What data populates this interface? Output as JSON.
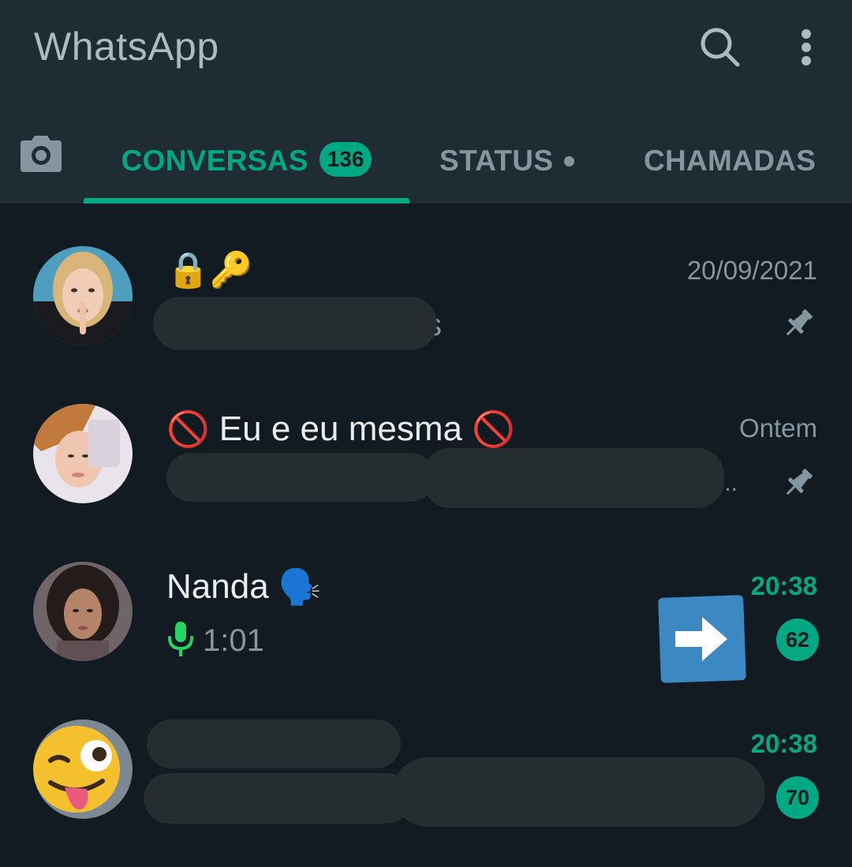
{
  "app": {
    "title": "WhatsApp",
    "search_icon": "search-icon",
    "menu_icon": "more-vert-icon"
  },
  "tabs": {
    "camera_icon": "camera-icon",
    "chats_label": "CONVERSAS",
    "chats_badge": "136",
    "status_label": "STATUS",
    "calls_label": "CHAMADAS",
    "active": "CONVERSAS"
  },
  "colors": {
    "accent": "#00a884",
    "header_bg": "#202c33",
    "list_bg": "#111b21"
  },
  "chats": [
    {
      "name": "🔒🔑",
      "time": "20/09/2021",
      "pinned": true,
      "preview_visible": "s",
      "unread": null
    },
    {
      "name_prefix": "🚫",
      "name": "Eu e eu mesma",
      "name_suffix": "🚫",
      "time": "Ontem",
      "pinned": true,
      "preview_visible": "...",
      "unread": null
    },
    {
      "name": "Nanda",
      "name_emoji": "🗣️",
      "time": "20:38",
      "pinned": false,
      "preview_icon": "mic-icon",
      "preview_duration": "1:01",
      "unread": "62",
      "overlay_icon": "right-arrow-icon"
    },
    {
      "name": "",
      "time": "20:38",
      "pinned": false,
      "unread": "70"
    }
  ]
}
